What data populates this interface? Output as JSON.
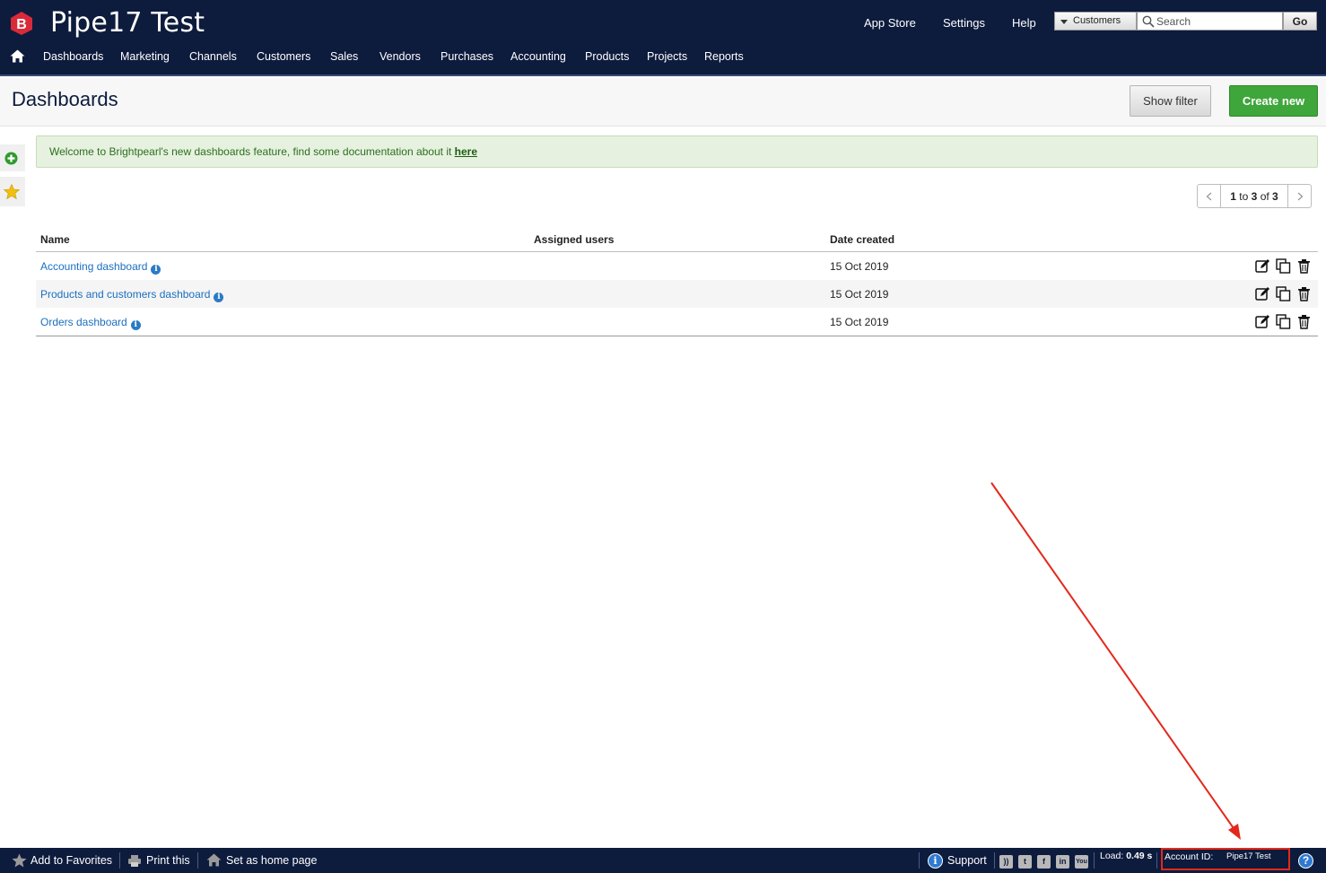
{
  "app": {
    "title": "Pipe17 Test"
  },
  "header": {
    "links": [
      "App Store",
      "Settings",
      "Help"
    ],
    "search": {
      "scope": "Customers",
      "placeholder": "Search",
      "go_label": "Go"
    }
  },
  "nav": [
    "Dashboards",
    "Marketing",
    "Channels",
    "Customers",
    "Sales",
    "Vendors",
    "Purchases",
    "Accounting",
    "Products",
    "Projects",
    "Reports"
  ],
  "page": {
    "title": "Dashboards",
    "show_filter_label": "Show filter",
    "create_new_label": "Create new"
  },
  "alert": {
    "text": "Welcome to Brightpearl's new dashboards feature, find some documentation about it ",
    "link": "here",
    "color": "#e6f2df"
  },
  "pager": {
    "from": "1",
    "to_word": "to",
    "to": "3",
    "of_word": "of",
    "total": "3"
  },
  "table": {
    "headers": {
      "name": "Name",
      "assigned": "Assigned users",
      "date": "Date created"
    },
    "rows": [
      {
        "name": "Accounting dashboard",
        "assigned": "",
        "date": "15 Oct 2019"
      },
      {
        "name": "Products and customers dashboard",
        "assigned": "",
        "date": "15 Oct 2019"
      },
      {
        "name": "Orders dashboard",
        "assigned": "",
        "date": "15 Oct 2019"
      }
    ],
    "row_actions": [
      "edit-icon",
      "copy-icon",
      "trash-icon"
    ]
  },
  "footer": {
    "add_favorites": "Add to Favorites",
    "print": "Print this",
    "set_home": "Set as home page",
    "support": "Support",
    "social_icons": [
      "rss-icon",
      "twitter-icon",
      "facebook-icon",
      "linkedin-icon",
      "youtube-icon"
    ],
    "load_label": "Load:",
    "load_value": "0.49 s",
    "account_label": "Account ID:",
    "account_value": "Pipe17 Test"
  },
  "colors": {
    "navy": "#0d1b3d",
    "green": "#3ea63a",
    "link": "#1a6fbf",
    "annotation": "#e3281b"
  }
}
